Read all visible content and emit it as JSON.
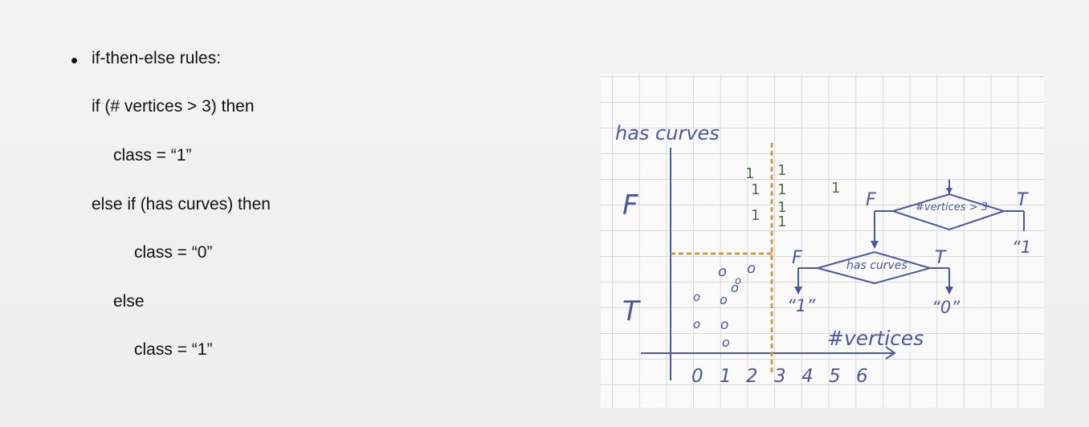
{
  "rules": {
    "heading": "if-then-else rules:",
    "lines": [
      "if (# vertices > 3) then",
      "class = “1”",
      "else if (has curves) then",
      "class = “0”",
      "else",
      "class = “1”"
    ]
  },
  "sketch": {
    "y_axis_label": "has curves",
    "x_axis_label": "#vertices",
    "y_tick_false": "F",
    "y_tick_true": "T",
    "x_ticks": [
      "0",
      "1",
      "2",
      "3",
      "4",
      "5",
      "6"
    ],
    "ones_points": [
      "1",
      "1",
      "1",
      "1",
      "1",
      "1",
      "1"
    ],
    "right_one": "1",
    "zeros_points": [
      "o",
      "o",
      "o",
      "o",
      "o",
      "o",
      "o",
      "o",
      "o"
    ],
    "tree": {
      "root_label": "#vertices > 3",
      "root_false": "F",
      "root_true": "T",
      "root_true_leaf": "“1",
      "child_label": "has curves",
      "child_false": "F",
      "child_true": "T",
      "child_false_leaf": "“1”",
      "child_true_leaf": "“0”"
    },
    "colors": {
      "ink": "#4a57a5",
      "green_ink": "#4d6f48",
      "dashed_line": "#d59a3b"
    }
  }
}
